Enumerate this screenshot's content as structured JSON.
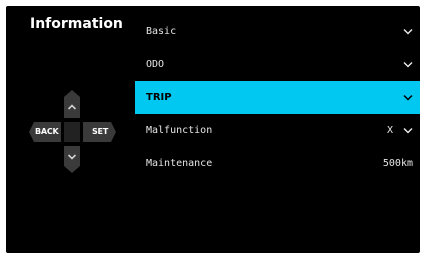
{
  "title": "Information",
  "menu": [
    {
      "label": "Basic",
      "value": "",
      "chevron": true,
      "selected": false
    },
    {
      "label": "ODO",
      "value": "",
      "chevron": true,
      "selected": false
    },
    {
      "label": "TRIP",
      "value": "",
      "chevron": true,
      "selected": true
    },
    {
      "label": "Malfunction",
      "value": "X",
      "chevron": true,
      "selected": false
    },
    {
      "label": "Maintenance",
      "value": "500km",
      "chevron": false,
      "selected": false
    }
  ],
  "dpad": {
    "back_label": "BACK",
    "set_label": "SET",
    "up_icon": "chevron-up-icon",
    "down_icon": "chevron-down-icon"
  },
  "colors": {
    "background": "#000000",
    "accent": "#00c8f0",
    "dpad": "#3a3a3a",
    "text": "#e6e6e6"
  }
}
